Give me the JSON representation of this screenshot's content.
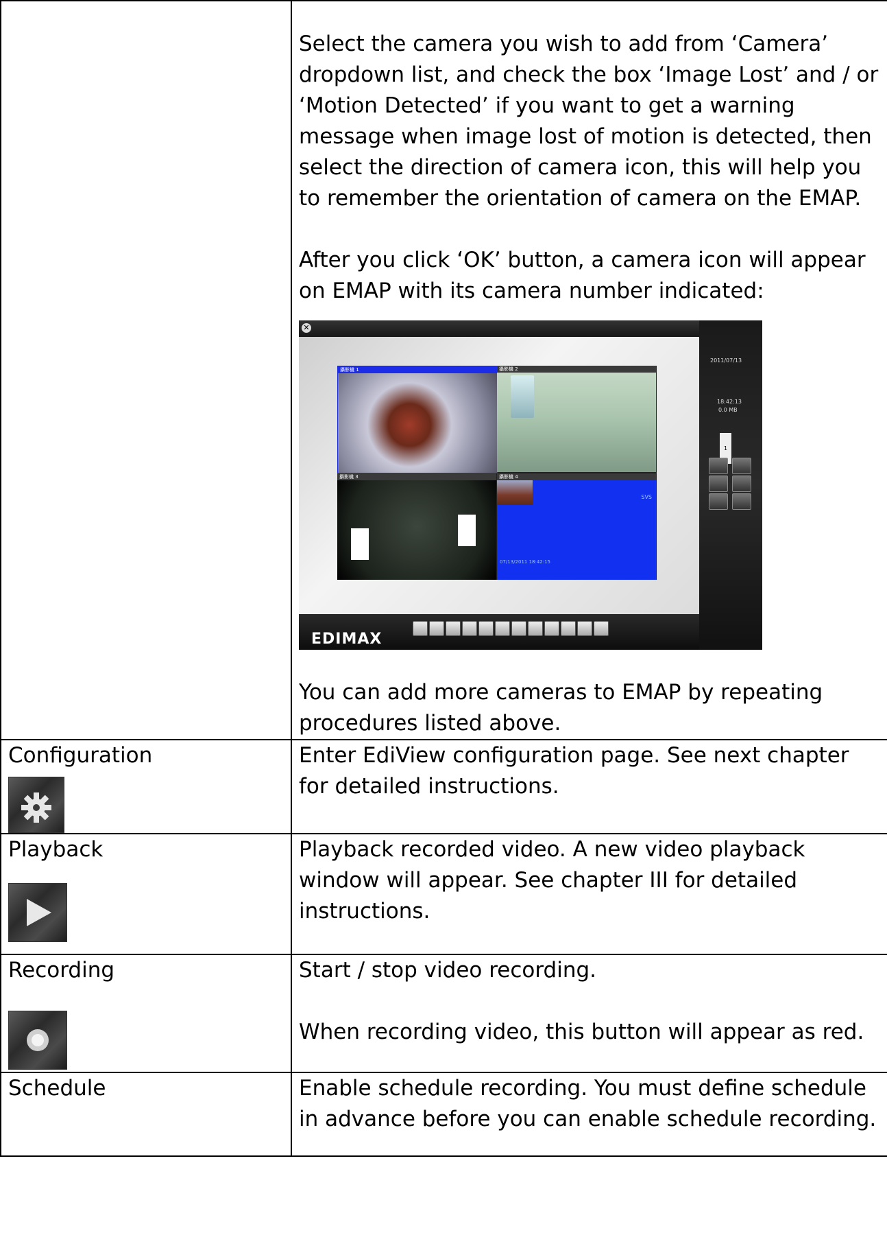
{
  "rows": [
    {
      "label": "",
      "paragraphs": [
        "Select the camera you wish to add from ‘Camera’ dropdown list, and check the box ‘Image Lost’ and / or ‘Motion Detected’ if you want to get a warning message when image lost of motion is detected, then select the direction of camera icon, this will help you to remember the orientation of camera on the EMAP.",
        "After you click ‘OK’ button, a camera icon will appear on EMAP with its camera number indicated:",
        "You can add more cameras to EMAP by repeating procedures listed above."
      ]
    },
    {
      "label": "Configuration",
      "icon": "gear-icon",
      "paragraphs": [
        "Enter EdiView configuration page. See next chapter for detailed instructions."
      ]
    },
    {
      "label": "Playback",
      "icon": "play-icon",
      "paragraphs": [
        "Playback recorded video. A new video playback window will appear. See chapter III for detailed instructions."
      ]
    },
    {
      "label": "Recording",
      "icon": "record-icon",
      "paragraphs": [
        "Start / stop video recording.",
        "When recording video, this button will appear as red."
      ]
    },
    {
      "label": "Schedule",
      "paragraphs": [
        "Enable schedule recording. You must define schedule in advance before you can enable schedule recording."
      ]
    }
  ],
  "screenshot": {
    "date": "2011/07/13",
    "time": "18:42:13",
    "size": "0.0 MB",
    "channel": "1",
    "logo": "EDIMAX",
    "cameras": [
      {
        "label": "攝影機 1"
      },
      {
        "label": "攝影機 2"
      },
      {
        "label": "攝影機 3"
      },
      {
        "label": "攝影機 4",
        "overlay": "SVS",
        "timestamp": "07/13/2011 18:42:15"
      }
    ]
  }
}
